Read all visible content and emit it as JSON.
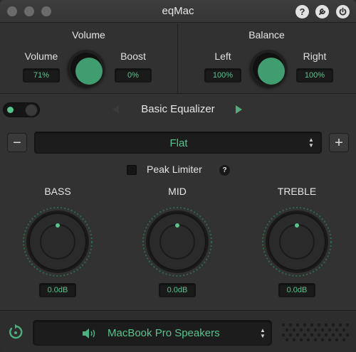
{
  "window": {
    "title": "eqMac"
  },
  "titlebar_icons": [
    "help-icon",
    "settings-icon",
    "power-icon"
  ],
  "volume": {
    "title": "Volume",
    "volume_label": "Volume",
    "volume_value": "71%",
    "boost_label": "Boost",
    "boost_value": "0%",
    "knob_level": 0.71
  },
  "balance": {
    "title": "Balance",
    "left_label": "Left",
    "left_value": "100%",
    "right_label": "Right",
    "right_value": "100%",
    "knob_level": 0.5
  },
  "equalizer": {
    "enabled": true,
    "title": "Basic Equalizer",
    "preset": "Flat",
    "minus_label": "−",
    "plus_label": "+",
    "peak_limiter_label": "Peak Limiter",
    "peak_limiter_checked": false,
    "help_label": "?",
    "bands": [
      {
        "label": "BASS",
        "value": "0.0dB"
      },
      {
        "label": "MID",
        "value": "0.0dB"
      },
      {
        "label": "TREBLE",
        "value": "0.0dB"
      }
    ]
  },
  "output": {
    "device": "MacBook Pro Speakers"
  },
  "colors": {
    "accent": "#58c48c",
    "knob_fill": "#3f9d70",
    "background": "#323232"
  }
}
